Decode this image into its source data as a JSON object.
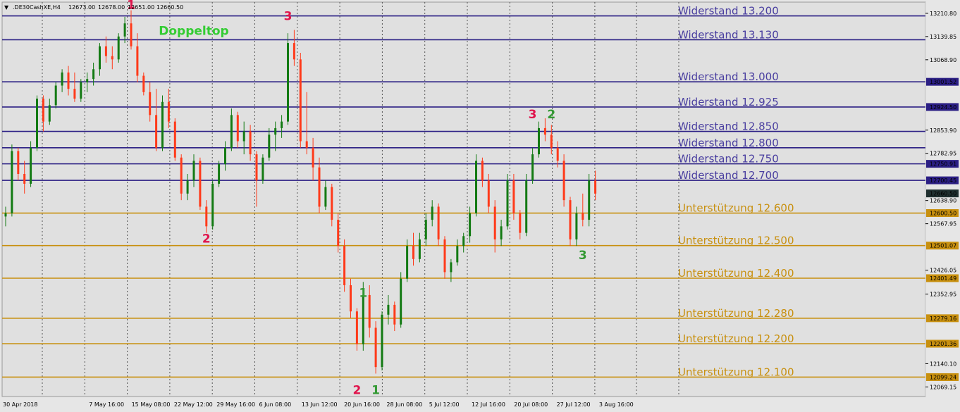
{
  "header": {
    "symbol": ".DE30CashXE,H4",
    "open": "12673.00",
    "high": "12678.00",
    "low": "12651.00",
    "close": "12660.50"
  },
  "chart_data": {
    "type": "candlestick",
    "title": "",
    "ylim": [
      12040,
      13245
    ],
    "y_ticks": [
      "13210.80",
      "13139.85",
      "13068.90",
      "12853.90",
      "12782.95",
      "12638.90",
      "12567.95",
      "12426.05",
      "12352.95",
      "12140.10",
      "12069.15"
    ],
    "x_ticks": [
      "30 Apr 2018",
      "7 May 16:00",
      "15 May 08:00",
      "22 May 12:00",
      "29 May 16:00",
      "6 Jun 08:00",
      "13 Jun 12:00",
      "20 Jun 16:00",
      "28 Jun 08:00",
      "5 Jul 12:00",
      "12 Jul 16:00",
      "20 Jul 08:00",
      "27 Jul 12:00",
      "3 Aug 16:00"
    ],
    "current_price": {
      "label": "12660.50",
      "value": 12660.5
    },
    "resistance": [
      {
        "label": "Widerstand 13.200",
        "value": 13203,
        "tag": ""
      },
      {
        "label": "Widerstand 13.130",
        "value": 13130,
        "tag": ""
      },
      {
        "label": "Widerstand 13.000",
        "value": 13001.52,
        "tag": "13001.52"
      },
      {
        "label": "Widerstand 12.925",
        "value": 12924.5,
        "tag": "12924.50"
      },
      {
        "label": "Widerstand 12.850",
        "value": 12850,
        "tag": ""
      },
      {
        "label": "Widerstand  12.800",
        "value": 12800,
        "tag": ""
      },
      {
        "label": "Widerstand 12.750",
        "value": 12750.91,
        "tag": "12750.91"
      },
      {
        "label": "Widerstand 12.700",
        "value": 12700.45,
        "tag": "12700.45"
      }
    ],
    "support": [
      {
        "label": "Unterstützung 12.600",
        "value": 12600.5,
        "tag": "12600.50"
      },
      {
        "label": "Unterstützung 12.500",
        "value": 12501.07,
        "tag": "12501.07"
      },
      {
        "label": "Unterstützung 12.400",
        "value": 12401.49,
        "tag": "12401.49"
      },
      {
        "label": "Unterstützung 12.280",
        "value": 12279.16,
        "tag": "12279.16"
      },
      {
        "label": "Unterstützung 12.200",
        "value": 12201.36,
        "tag": "12201.36"
      },
      {
        "label": "Unterstützung 12.100",
        "value": 12099.24,
        "tag": "12099.24"
      }
    ],
    "annotations": [
      {
        "text": "1",
        "color": "#e0144c",
        "x_index": 20,
        "price": 13225
      },
      {
        "text": "2",
        "color": "#e0144c",
        "x_index": 32,
        "price": 12510
      },
      {
        "text": "Doppeltop",
        "color": "#33cc33",
        "x_index": 30,
        "price": 13145
      },
      {
        "text": "3",
        "color": "#e0144c",
        "x_index": 45,
        "price": 13190
      },
      {
        "text": "1",
        "color": "#339933",
        "x_index": 57,
        "price": 12345
      },
      {
        "text": "2",
        "color": "#e0144c",
        "x_index": 56,
        "price": 12048
      },
      {
        "text": "1",
        "color": "#339933",
        "x_index": 59,
        "price": 12048
      },
      {
        "text": "3",
        "color": "#e0144c",
        "x_index": 84,
        "price": 12890
      },
      {
        "text": "2",
        "color": "#339933",
        "x_index": 87,
        "price": 12890
      },
      {
        "text": "3",
        "color": "#339933",
        "x_index": 92,
        "price": 12460
      }
    ],
    "series": [
      {
        "name": "",
        "ohlc": [
          [
            12590,
            12620,
            12560,
            12600
          ],
          [
            12600,
            12810,
            12590,
            12790
          ],
          [
            12790,
            12800,
            12700,
            12720
          ],
          [
            12720,
            12760,
            12660,
            12690
          ],
          [
            12690,
            12820,
            12680,
            12800
          ],
          [
            12800,
            12960,
            12790,
            12950
          ],
          [
            12950,
            12960,
            12850,
            12880
          ],
          [
            12880,
            12950,
            12870,
            12930
          ],
          [
            12930,
            13000,
            12920,
            12990
          ],
          [
            12990,
            13040,
            12970,
            13030
          ],
          [
            13030,
            13050,
            12960,
            12980
          ],
          [
            12980,
            13030,
            12940,
            12950
          ],
          [
            12950,
            13010,
            12940,
            13000
          ],
          [
            13000,
            13030,
            12970,
            13010
          ],
          [
            13010,
            13060,
            12990,
            13040
          ],
          [
            13040,
            13120,
            13020,
            13110
          ],
          [
            13110,
            13140,
            13060,
            13080
          ],
          [
            13080,
            13110,
            13040,
            13070
          ],
          [
            13070,
            13150,
            13060,
            13140
          ],
          [
            13140,
            13200,
            13120,
            13180
          ],
          [
            13180,
            13220,
            13100,
            13110
          ],
          [
            13110,
            13150,
            13000,
            13020
          ],
          [
            13020,
            13030,
            12960,
            12970
          ],
          [
            12970,
            13000,
            12880,
            12900
          ],
          [
            12900,
            12980,
            12790,
            12800
          ],
          [
            12800,
            12960,
            12790,
            12940
          ],
          [
            12940,
            12980,
            12860,
            12880
          ],
          [
            12880,
            12890,
            12760,
            12770
          ],
          [
            12770,
            12780,
            12640,
            12660
          ],
          [
            12660,
            12720,
            12640,
            12700
          ],
          [
            12700,
            12780,
            12680,
            12760
          ],
          [
            12760,
            12770,
            12610,
            12620
          ],
          [
            12620,
            12640,
            12540,
            12560
          ],
          [
            12560,
            12700,
            12550,
            12690
          ],
          [
            12690,
            12760,
            12680,
            12750
          ],
          [
            12750,
            12820,
            12730,
            12800
          ],
          [
            12800,
            12920,
            12790,
            12900
          ],
          [
            12900,
            12910,
            12800,
            12820
          ],
          [
            12820,
            12880,
            12780,
            12850
          ],
          [
            12850,
            12870,
            12760,
            12780
          ],
          [
            12780,
            12790,
            12620,
            12700
          ],
          [
            12700,
            12780,
            12690,
            12770
          ],
          [
            12770,
            12860,
            12760,
            12840
          ],
          [
            12840,
            12880,
            12790,
            12860
          ],
          [
            12860,
            12900,
            12830,
            12880
          ],
          [
            12880,
            13150,
            12870,
            13120
          ],
          [
            13120,
            13160,
            13050,
            13070
          ],
          [
            13070,
            13090,
            12800,
            12820
          ],
          [
            12820,
            12970,
            12780,
            12800
          ],
          [
            12800,
            12830,
            12700,
            12740
          ],
          [
            12740,
            12770,
            12600,
            12620
          ],
          [
            12620,
            12700,
            12610,
            12680
          ],
          [
            12680,
            12690,
            12560,
            12580
          ],
          [
            12580,
            12600,
            12480,
            12500
          ],
          [
            12500,
            12520,
            12360,
            12380
          ],
          [
            12380,
            12400,
            12280,
            12300
          ],
          [
            12300,
            12310,
            12180,
            12200
          ],
          [
            12200,
            12390,
            12180,
            12350
          ],
          [
            12350,
            12380,
            12220,
            12250
          ],
          [
            12250,
            12270,
            12110,
            12130
          ],
          [
            12130,
            12300,
            12120,
            12290
          ],
          [
            12290,
            12350,
            12260,
            12320
          ],
          [
            12320,
            12330,
            12240,
            12260
          ],
          [
            12260,
            12420,
            12250,
            12400
          ],
          [
            12400,
            12520,
            12390,
            12500
          ],
          [
            12500,
            12540,
            12440,
            12460
          ],
          [
            12460,
            12540,
            12450,
            12520
          ],
          [
            12520,
            12600,
            12500,
            12580
          ],
          [
            12580,
            12640,
            12560,
            12620
          ],
          [
            12620,
            12630,
            12500,
            12520
          ],
          [
            12520,
            12530,
            12400,
            12420
          ],
          [
            12420,
            12460,
            12390,
            12450
          ],
          [
            12450,
            12520,
            12440,
            12500
          ],
          [
            12500,
            12540,
            12480,
            12530
          ],
          [
            12530,
            12620,
            12510,
            12600
          ],
          [
            12600,
            12780,
            12590,
            12760
          ],
          [
            12760,
            12770,
            12680,
            12700
          ],
          [
            12700,
            12720,
            12600,
            12620
          ],
          [
            12620,
            12640,
            12480,
            12520
          ],
          [
            12520,
            12580,
            12500,
            12560
          ],
          [
            12560,
            12720,
            12550,
            12700
          ],
          [
            12700,
            12720,
            12580,
            12600
          ],
          [
            12600,
            12610,
            12520,
            12540
          ],
          [
            12540,
            12720,
            12530,
            12700
          ],
          [
            12700,
            12800,
            12690,
            12780
          ],
          [
            12780,
            12880,
            12770,
            12860
          ],
          [
            12860,
            12890,
            12820,
            12840
          ],
          [
            12840,
            12870,
            12780,
            12800
          ],
          [
            12800,
            12820,
            12740,
            12760
          ],
          [
            12760,
            12780,
            12620,
            12640
          ],
          [
            12640,
            12650,
            12500,
            12520
          ],
          [
            12520,
            12620,
            12500,
            12600
          ],
          [
            12600,
            12660,
            12560,
            12580
          ],
          [
            12580,
            12720,
            12560,
            12700
          ],
          [
            12700,
            12730,
            12640,
            12660
          ]
        ]
      }
    ]
  }
}
